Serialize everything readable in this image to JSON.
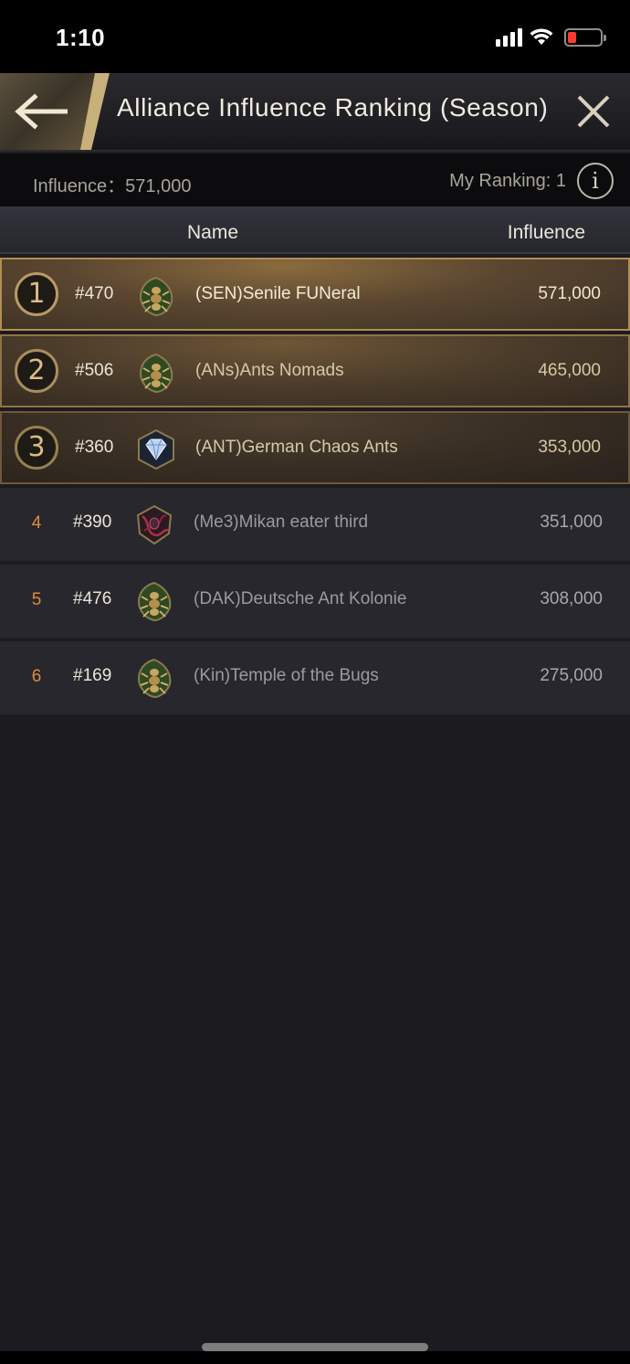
{
  "status_bar": {
    "time": "1:10"
  },
  "header": {
    "title": "Alliance Influence Ranking (Season)",
    "back_icon": "arrow-left-icon",
    "close_icon": "close-icon"
  },
  "summary": {
    "influence": "Influence：571,000",
    "my_ranking": "My Ranking: 1",
    "info_label": "i"
  },
  "columns": {
    "name": "Name",
    "influence": "Influence"
  },
  "rows": [
    {
      "rank": "1",
      "id": "#470",
      "name": "(SEN)Senile FUNeral",
      "influence": "571,000",
      "emblem": "ant-leaf-emblem"
    },
    {
      "rank": "2",
      "id": "#506",
      "name": "(ANs)Ants Nomads",
      "influence": "465,000",
      "emblem": "ant-leaf-emblem"
    },
    {
      "rank": "3",
      "id": "#360",
      "name": "(ANT)German Chaos Ants",
      "influence": "353,000",
      "emblem": "diamond-emblem"
    },
    {
      "rank": "4",
      "id": "#390",
      "name": "(Me3)Mikan eater third",
      "influence": "351,000",
      "emblem": "ant-red-vine-emblem"
    },
    {
      "rank": "5",
      "id": "#476",
      "name": "(DAK)Deutsche Ant Kolonie",
      "influence": "308,000",
      "emblem": "ant-leaf-emblem"
    },
    {
      "rank": "6",
      "id": "#169",
      "name": "(Kin)Temple of the Bugs",
      "influence": "275,000",
      "emblem": "ant-leaf-emblem"
    }
  ],
  "colors": {
    "gold_accent": "#b48e52",
    "rank_number_orange": "#e08a3c",
    "background": "#1c1b20"
  }
}
